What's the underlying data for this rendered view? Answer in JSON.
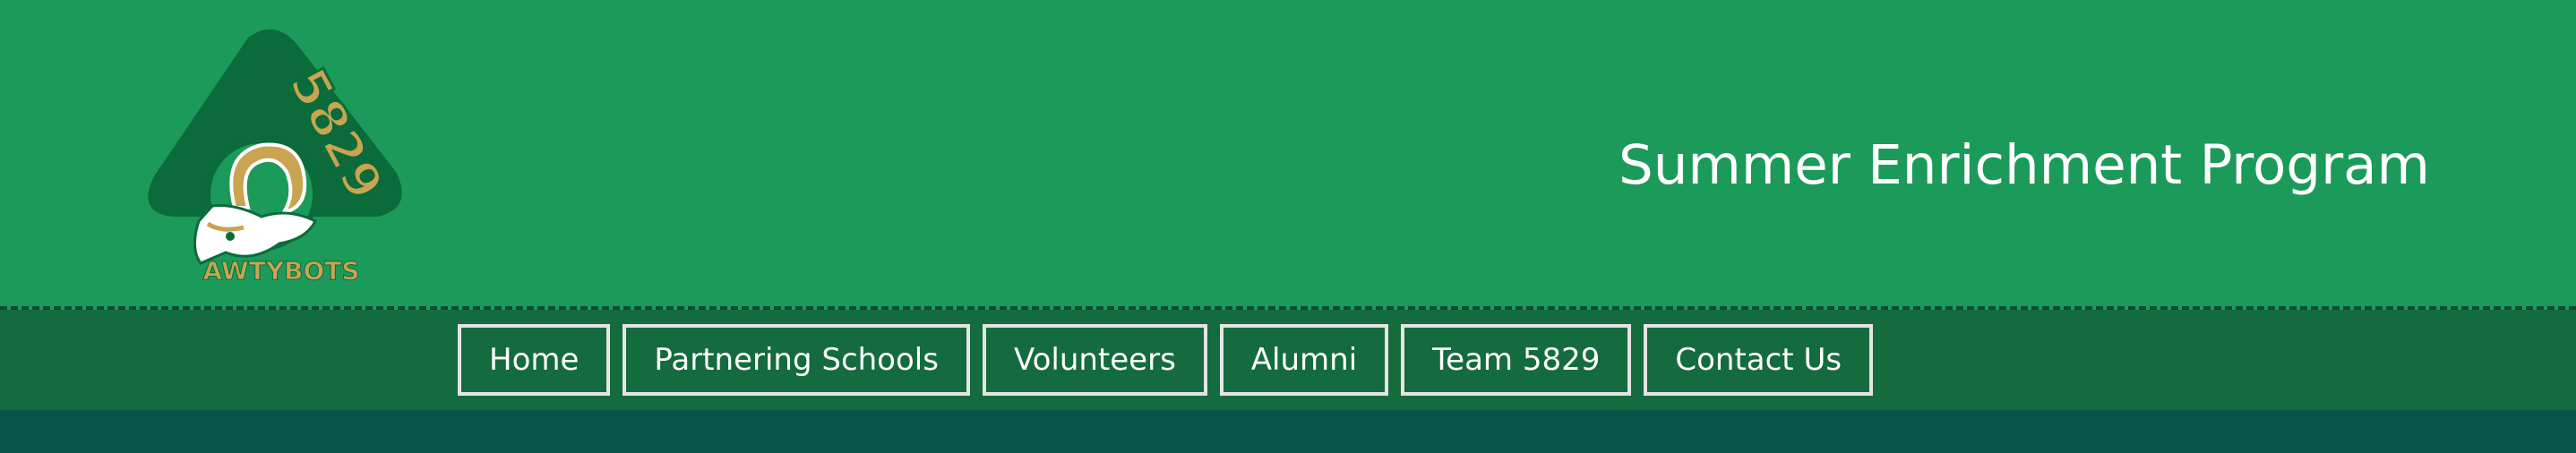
{
  "header": {
    "title": "Summer Enrichment Program",
    "logo": {
      "number": "5829",
      "name": "AWTYBOTS",
      "icon": "ram-mascot-logo"
    }
  },
  "nav": {
    "items": [
      {
        "label": "Home"
      },
      {
        "label": "Partnering Schools"
      },
      {
        "label": "Volunteers"
      },
      {
        "label": "Alumni"
      },
      {
        "label": "Team 5829"
      },
      {
        "label": "Contact Us"
      }
    ]
  },
  "colors": {
    "header_bg": "#1c9a5a",
    "nav_bg": "#146b3d",
    "footer_bg": "#07534a",
    "logo_dark": "#0b6b3a",
    "logo_gold": "#c9a451"
  }
}
